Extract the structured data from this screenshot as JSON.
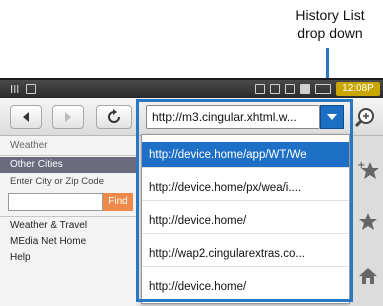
{
  "callout": {
    "line1": "History List",
    "line2": "drop down"
  },
  "statusbar": {
    "signal": "Ill",
    "time": "12:08P"
  },
  "toolbar": {
    "url": "http://m3.cingular.xhtml.w...",
    "back_icon": "back-arrow-icon",
    "forward_icon": "forward-arrow-icon",
    "reload_icon": "reload-icon",
    "dropdown_icon": "chevron-down-icon",
    "zoom_icon": "zoom-icon"
  },
  "left_menu": {
    "weather": "Weather",
    "other_cities": "Other Cities",
    "enter_city": "Enter City or Zip Code",
    "find": "Find",
    "weather_travel": "Weather & Travel",
    "media_net_home": "MEdia Net Home",
    "help": "Help"
  },
  "history": [
    "http://device.home/app/WT/We",
    "http://device.home/px/wea/i....",
    "http://device.home/",
    "http://wap2.cingularextras.co...",
    "http://device.home/"
  ],
  "colors": {
    "accent": "#1e6fc6",
    "find_button": "#f08a4b",
    "selected_menu": "#6a6a7e",
    "clock_bg": "#c9a700"
  }
}
